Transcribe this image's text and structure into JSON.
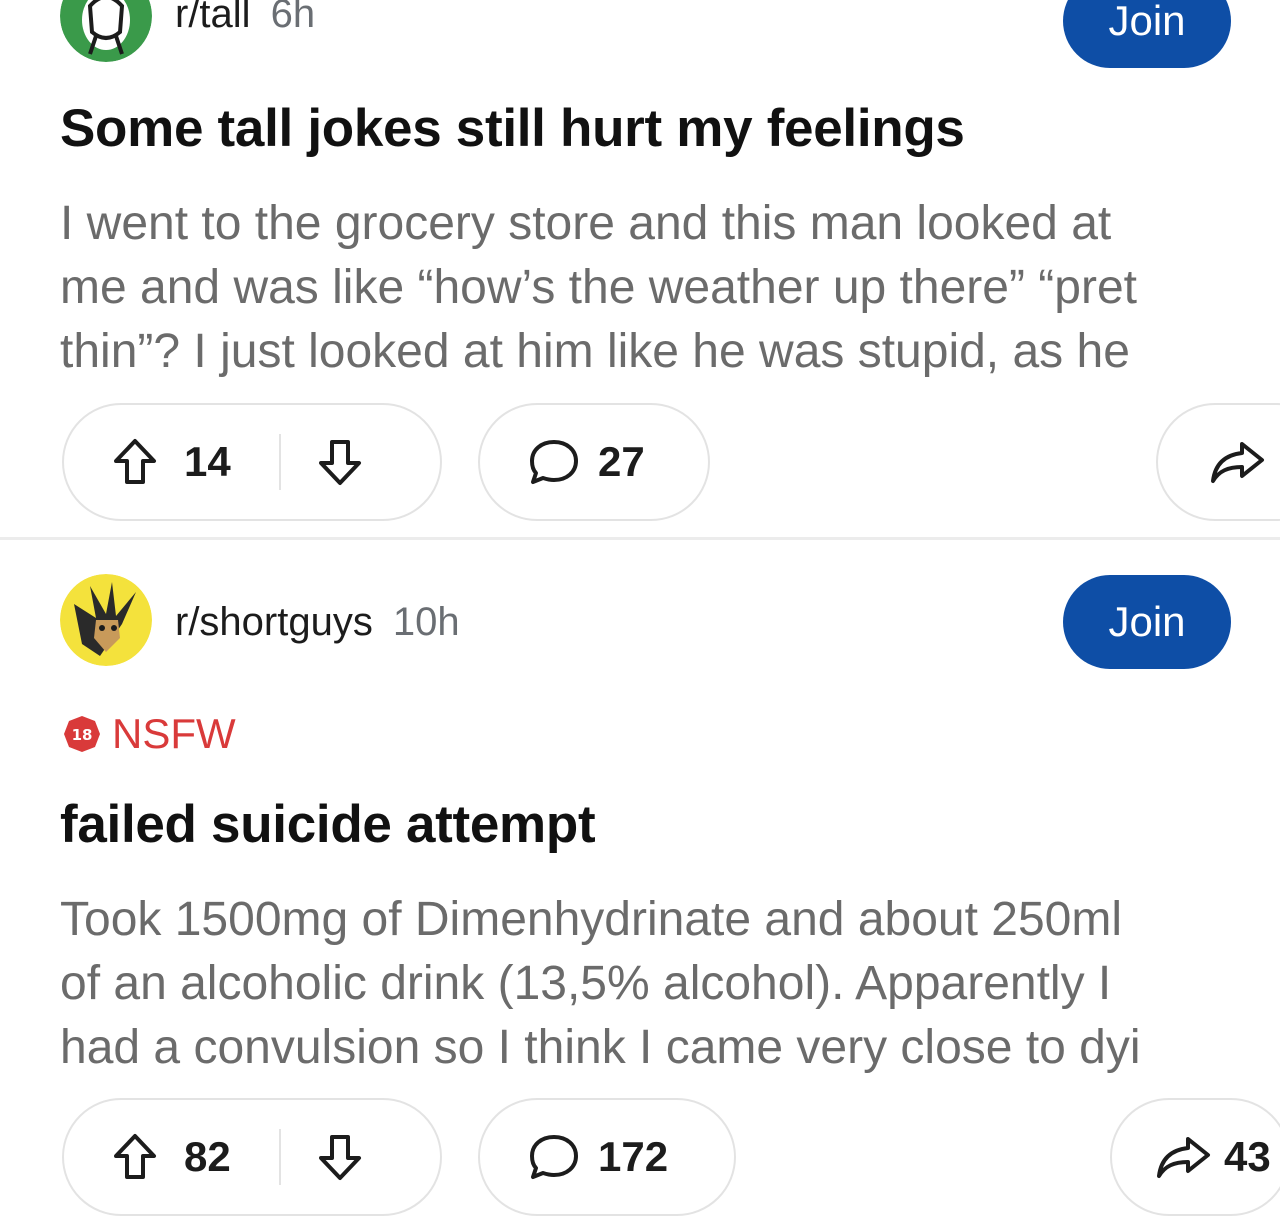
{
  "colors": {
    "join_blue": "#0e4ea6",
    "nsfw_red": "#d93a3a",
    "body_gray": "#6b6b6b",
    "title_black": "#111111"
  },
  "posts": [
    {
      "subreddit": "r/tall",
      "time": "6h",
      "join_label": "Join",
      "title": "Some tall jokes still hurt my feelings",
      "body_lines": [
        "I went to the grocery store and this man looked at",
        "me and was like “how’s the weather up there” “pret",
        "thin”? I just looked at him like he was stupid, as he"
      ],
      "upvotes": "14",
      "comments": "27",
      "shares": ""
    },
    {
      "subreddit": "r/shortguys",
      "time": "10h",
      "join_label": "Join",
      "nsfw_badge": "18",
      "nsfw_label": "NSFW",
      "title": "failed suicide attempt",
      "body_lines": [
        "Took 1500mg of Dimenhydrinate and about 250ml",
        "of an alcoholic drink (13,5% alcohol). Apparently I",
        "had a convulsion so I think I came very close to dyi"
      ],
      "upvotes": "82",
      "comments": "172",
      "shares": "43"
    }
  ]
}
